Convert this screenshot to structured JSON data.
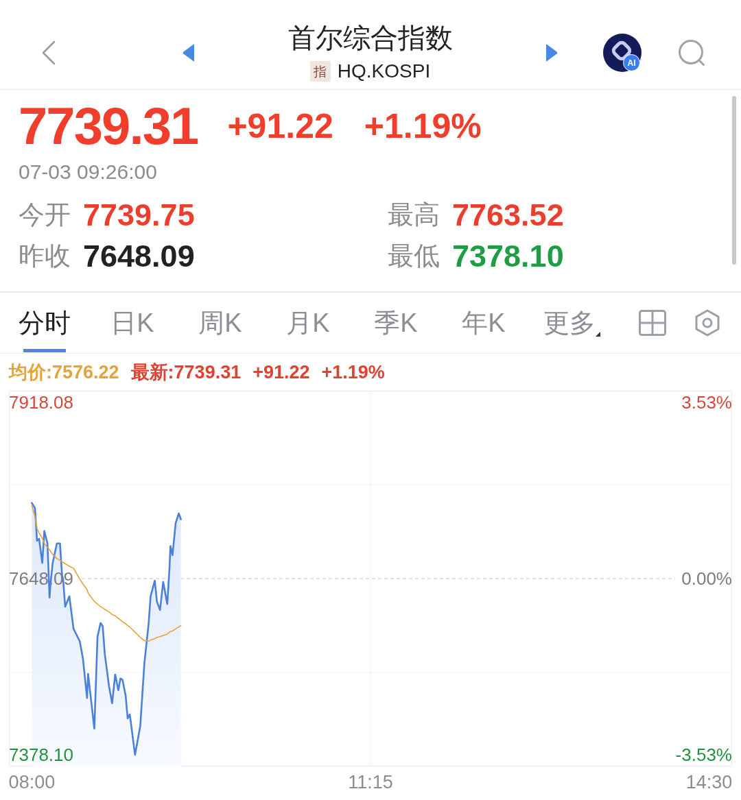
{
  "header": {
    "title": "首尔综合指数",
    "badge": "指",
    "code": "HQ.KOSPI",
    "ai_badge": "AI"
  },
  "quote": {
    "price": "7739.31",
    "change": "+91.22",
    "change_percent": "+1.19%",
    "time": "07-03 09:26:00"
  },
  "stats": [
    {
      "label": "今开",
      "value": "7739.75",
      "color": "#ea3f2e"
    },
    {
      "label": "最高",
      "value": "7763.52",
      "color": "#ea3f2e"
    },
    {
      "label": "昨收",
      "value": "7648.09",
      "color": "#222222"
    },
    {
      "label": "最低",
      "value": "7378.10",
      "color": "#1f9d45"
    }
  ],
  "tabs": [
    {
      "label": "分时",
      "selected": true,
      "kind": "tab"
    },
    {
      "label": "日K",
      "selected": false,
      "kind": "tab"
    },
    {
      "label": "周K",
      "selected": false,
      "kind": "tab"
    },
    {
      "label": "月K",
      "selected": false,
      "kind": "tab"
    },
    {
      "label": "季K",
      "selected": false,
      "kind": "tab"
    },
    {
      "label": "年K",
      "selected": false,
      "kind": "tab"
    },
    {
      "label": "更多",
      "selected": false,
      "kind": "menu"
    }
  ],
  "chart": {
    "legend": [
      {
        "text": "均价:7576.22",
        "color": "#e8a23a"
      },
      {
        "text": "最新:7739.31",
        "color": "#e0422f"
      },
      {
        "text": "+91.22",
        "color": "#e0422f"
      },
      {
        "text": "+1.19%",
        "color": "#e0422f"
      }
    ],
    "percent_axis": [
      {
        "text": "3.53%",
        "color": "#d5473a"
      },
      {
        "text": "0.00%",
        "color": "#7c7c7c"
      },
      {
        "text": "-3.53%",
        "color": "#23923f"
      }
    ],
    "chart_data": {
      "type": "line",
      "x": [
        8.0,
        8.03,
        8.05,
        8.07,
        8.1,
        8.12,
        8.15,
        8.17,
        8.18,
        8.2,
        8.24,
        8.27,
        8.29,
        8.3,
        8.32,
        8.36,
        8.4,
        8.46,
        8.49,
        8.53,
        8.54,
        8.6,
        8.63,
        8.66,
        8.68,
        8.7,
        8.74,
        8.77,
        8.8,
        8.83,
        8.85,
        8.87,
        8.9,
        8.92,
        8.94,
        8.99,
        9.04,
        9.08,
        9.12,
        9.14,
        9.18,
        9.2,
        9.23,
        9.26,
        9.3,
        9.32,
        9.33,
        9.35,
        9.38,
        9.41,
        9.43
      ],
      "series": [
        {
          "type": "area",
          "color": "#4a80d9",
          "values": [
            7764,
            7756,
            7706,
            7709,
            7672,
            7721,
            7702,
            7619,
            7641,
            7672,
            7702,
            7702,
            7653,
            7647,
            7605,
            7621,
            7571,
            7552,
            7526,
            7465,
            7502,
            7418,
            7559,
            7580,
            7575,
            7533,
            7484,
            7457,
            7501,
            7477,
            7495,
            7493,
            7469,
            7434,
            7440,
            7378,
            7422,
            7518,
            7578,
            7621,
            7645,
            7613,
            7600,
            7643,
            7609,
            7662,
            7698,
            7684,
            7733,
            7748,
            7739
          ]
        },
        {
          "type": "line",
          "color": "#e8a23a",
          "values": [
            7760,
            7743,
            7725,
            7718,
            7710,
            7702,
            7696,
            7692,
            7690,
            7685,
            7679,
            7676,
            7674,
            7673,
            7671,
            7667,
            7664,
            7647,
            7640,
            7631,
            7626,
            7613,
            7609,
            7605,
            7603,
            7601,
            7597,
            7593,
            7591,
            7587,
            7585,
            7582,
            7579,
            7576,
            7574,
            7566,
            7558,
            7553,
            7552,
            7554,
            7556,
            7558,
            7559,
            7561,
            7563,
            7566,
            7567,
            7568,
            7571,
            7574,
            7576
          ]
        }
      ],
      "xlim": [
        7.78,
        14.72
      ],
      "ylim": [
        7360.24,
        7935.94
      ],
      "xticks": [
        {
          "value": 8,
          "label": "08:00"
        },
        {
          "value": 11.25,
          "label": "11:15"
        },
        {
          "value": 14.5,
          "label": "14:30"
        }
      ],
      "yticks": [
        {
          "value": 7378.1,
          "label": "7378.10"
        },
        {
          "value": 7648.09,
          "label": "7648.09"
        },
        {
          "value": 7918.08,
          "label": "7918.08"
        }
      ],
      "ref_lines": [
        {
          "axis": "y",
          "value": 7648.09
        }
      ]
    }
  }
}
